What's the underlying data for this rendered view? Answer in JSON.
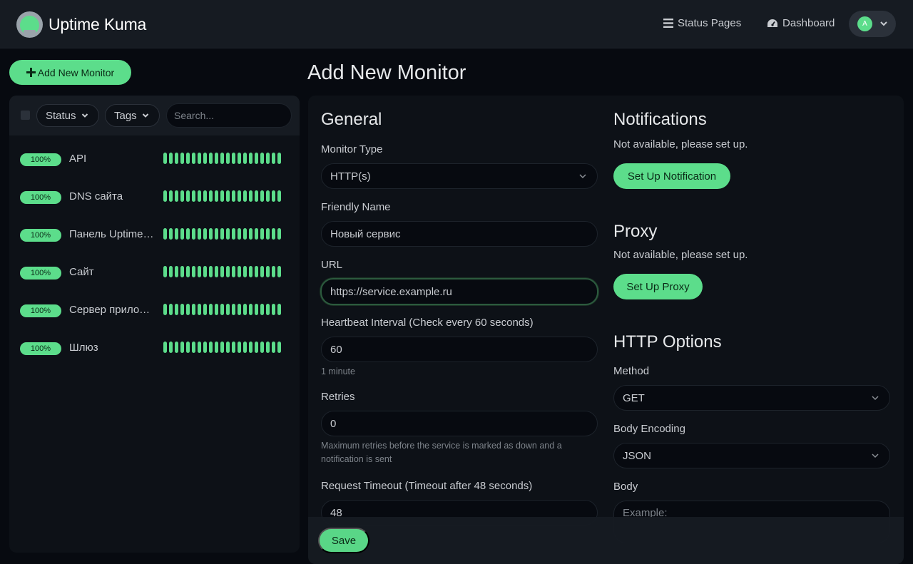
{
  "app": {
    "name": "Uptime Kuma"
  },
  "nav": {
    "status_pages": "Status Pages",
    "dashboard": "Dashboard",
    "avatar_letter": "A"
  },
  "sidebar": {
    "add_button": "Add New Monitor",
    "filters": {
      "status": "Status",
      "tags": "Tags"
    },
    "search": {
      "placeholder": "Search...",
      "value": ""
    },
    "monitors": [
      {
        "uptime": "100%",
        "name": "API"
      },
      {
        "uptime": "100%",
        "name": "DNS сайта"
      },
      {
        "uptime": "100%",
        "name": "Панель Uptime Kuma"
      },
      {
        "uptime": "100%",
        "name": "Сайт"
      },
      {
        "uptime": "100%",
        "name": "Сервер приложений"
      },
      {
        "uptime": "100%",
        "name": "Шлюз"
      }
    ]
  },
  "page": {
    "title": "Add New Monitor"
  },
  "general": {
    "heading": "General",
    "monitor_type": {
      "label": "Monitor Type",
      "value": "HTTP(s)"
    },
    "friendly_name": {
      "label": "Friendly Name",
      "value": "Новый сервис"
    },
    "url": {
      "label": "URL",
      "value": "https://service.example.ru"
    },
    "interval": {
      "label": "Heartbeat Interval (Check every 60 seconds)",
      "value": "60",
      "help": "1 minute"
    },
    "retries": {
      "label": "Retries",
      "value": "0",
      "help": "Maximum retries before the service is marked as down and a notification is sent"
    },
    "timeout": {
      "label": "Request Timeout (Timeout after 48 seconds)",
      "value": "48"
    }
  },
  "notifications": {
    "heading": "Notifications",
    "text": "Not available, please set up.",
    "button": "Set Up Notification"
  },
  "proxy": {
    "heading": "Proxy",
    "text": "Not available, please set up.",
    "button": "Set Up Proxy"
  },
  "http_options": {
    "heading": "HTTP Options",
    "method": {
      "label": "Method",
      "value": "GET"
    },
    "body_encoding": {
      "label": "Body Encoding",
      "value": "JSON"
    },
    "body": {
      "label": "Body",
      "placeholder": "Example:"
    }
  },
  "footer": {
    "save": "Save"
  },
  "colors": {
    "accent": "#5cdd8b",
    "background": "#070a10",
    "panel": "#0d1117",
    "header": "#161b22"
  }
}
